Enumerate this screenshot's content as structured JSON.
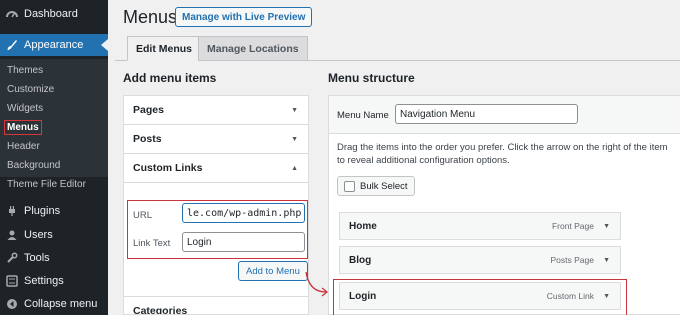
{
  "sidebar": {
    "items": [
      {
        "label": "Dashboard",
        "icon": "dashboard-icon"
      },
      {
        "label": "Appearance",
        "icon": "brush-icon"
      },
      {
        "label": "Plugins",
        "icon": "plugin-icon"
      },
      {
        "label": "Users",
        "icon": "users-icon"
      },
      {
        "label": "Tools",
        "icon": "wrench-icon"
      },
      {
        "label": "Settings",
        "icon": "settings-icon"
      },
      {
        "label": "Collapse menu",
        "icon": "collapse-icon"
      }
    ],
    "submenu": [
      "Themes",
      "Customize",
      "Widgets",
      "Menus",
      "Header",
      "Background",
      "Theme File Editor"
    ],
    "current_submenu": "Menus"
  },
  "header": {
    "title": "Menus",
    "live_preview": "Manage with Live Preview"
  },
  "tabs": [
    {
      "label": "Edit Menus",
      "active": true
    },
    {
      "label": "Manage Locations",
      "active": false
    }
  ],
  "left": {
    "heading": "Add menu items",
    "sections": [
      "Pages",
      "Posts",
      "Custom Links",
      "Categories"
    ],
    "custom_links": {
      "url_label": "URL",
      "url_value": "le.com/wp-admin.php",
      "link_text_label": "Link Text",
      "link_text_value": "Login",
      "add_button": "Add to Menu"
    }
  },
  "right": {
    "heading": "Menu structure",
    "menu_name_label": "Menu Name",
    "menu_name_value": "Navigation Menu",
    "description": "Drag the items into the order you prefer. Click the arrow on the right of the item to reveal additional configuration options.",
    "bulk_select": "Bulk Select",
    "items": [
      {
        "label": "Home",
        "type": "Front Page"
      },
      {
        "label": "Blog",
        "type": "Posts Page"
      },
      {
        "label": "Login",
        "type": "Custom Link"
      }
    ]
  },
  "colors": {
    "sidebar_bg": "#1d2327",
    "accent": "#2271b1",
    "highlight": "#c9353e"
  }
}
